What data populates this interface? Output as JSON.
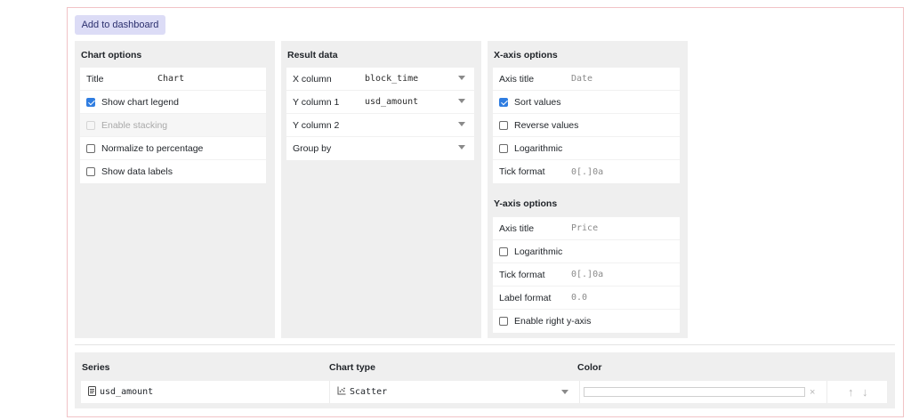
{
  "toolbar": {
    "add_to_dashboard": "Add to dashboard"
  },
  "chart_options": {
    "title": "Chart options",
    "title_label": "Title",
    "title_value": "Chart",
    "show_legend": {
      "label": "Show chart legend",
      "checked": true
    },
    "enable_stacking": {
      "label": "Enable stacking",
      "checked": false,
      "disabled": true
    },
    "normalize": {
      "label": "Normalize to percentage",
      "checked": false
    },
    "show_labels": {
      "label": "Show data labels",
      "checked": false
    }
  },
  "result_data": {
    "title": "Result data",
    "x_column": {
      "label": "X column",
      "value": "block_time"
    },
    "y_column_1": {
      "label": "Y column 1",
      "value": "usd_amount"
    },
    "y_column_2": {
      "label": "Y column 2",
      "value": ""
    },
    "group_by": {
      "label": "Group by",
      "value": ""
    }
  },
  "x_axis": {
    "title": "X-axis options",
    "axis_title_label": "Axis title",
    "axis_title_value": "Date",
    "sort_values": {
      "label": "Sort values",
      "checked": true
    },
    "reverse_values": {
      "label": "Reverse values",
      "checked": false
    },
    "logarithmic": {
      "label": "Logarithmic",
      "checked": false
    },
    "tick_format_label": "Tick format",
    "tick_format_value": "0[.]0a"
  },
  "y_axis": {
    "title": "Y-axis options",
    "axis_title_label": "Axis title",
    "axis_title_value": "Price",
    "logarithmic": {
      "label": "Logarithmic",
      "checked": false
    },
    "tick_format_label": "Tick format",
    "tick_format_value": "0[.]0a",
    "label_format_label": "Label format",
    "label_format_value": "0.0",
    "right_axis": {
      "label": "Enable right y-axis",
      "checked": false
    }
  },
  "series": {
    "headers": {
      "series": "Series",
      "chart_type": "Chart type",
      "color": "Color"
    },
    "rows": [
      {
        "name": "usd_amount",
        "chart_type": "Scatter",
        "color": ""
      }
    ]
  },
  "icons": {
    "clear": "×",
    "up": "↑",
    "down": "↓"
  },
  "colors": {
    "checkbox": "#2f7de1",
    "button_bg": "#dcdcf6",
    "panel_bg": "#efefef",
    "frame_border": "#f1c3c6"
  }
}
